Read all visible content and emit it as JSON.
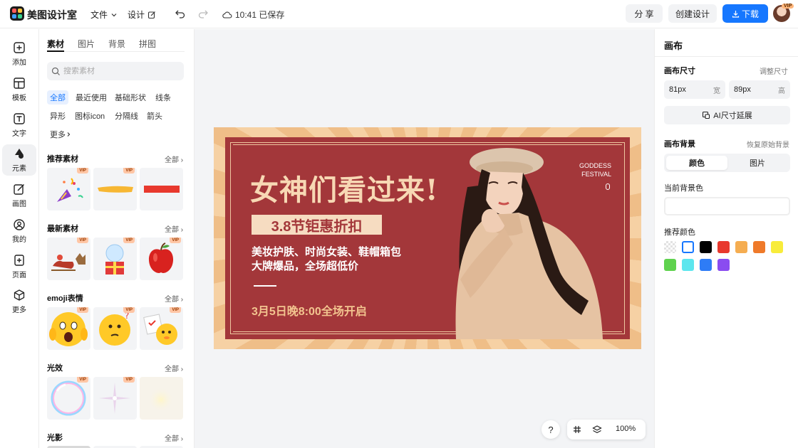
{
  "app": {
    "name": "美图设计室"
  },
  "header": {
    "file_menu": "文件",
    "design_menu": "设计",
    "save_status": "10:41 已保存",
    "share_label": "分 享",
    "create_label": "创建设计",
    "download_label": "下载",
    "vip_badge": "VIP"
  },
  "rail": {
    "items": [
      {
        "label": "添加",
        "icon": "plus-square-icon"
      },
      {
        "label": "模板",
        "icon": "template-icon"
      },
      {
        "label": "文字",
        "icon": "text-icon"
      },
      {
        "label": "元素",
        "icon": "shapes-icon"
      },
      {
        "label": "画图",
        "icon": "draw-icon"
      },
      {
        "label": "我的",
        "icon": "user-icon"
      },
      {
        "label": "页面",
        "icon": "add-page-icon"
      },
      {
        "label": "更多",
        "icon": "cube-icon"
      }
    ],
    "active": "元素"
  },
  "panel": {
    "tabs": [
      "素材",
      "图片",
      "背景",
      "拼图"
    ],
    "active_tab": "素材",
    "search_placeholder": "搜索素材",
    "chips": [
      "全部",
      "最近使用",
      "基础形状",
      "线条",
      "异形",
      "图标icon",
      "分隔线",
      "箭头",
      "更多"
    ],
    "active_chip": "全部",
    "sections": [
      {
        "title": "推荐素材",
        "all": "全部"
      },
      {
        "title": "最新素材",
        "all": "全部"
      },
      {
        "title": "emoji表情",
        "all": "全部"
      },
      {
        "title": "光效",
        "all": "全部"
      },
      {
        "title": "光影",
        "all": "全部"
      }
    ],
    "vip_label": "VIP"
  },
  "poster": {
    "headline": "女神们看过来!",
    "tag": "3.8节钜惠折扣",
    "line1": "美妆护肤、时尚女装、鞋帽箱包",
    "line2": "大牌爆品，全场超低价",
    "date": "3月5日晚8:00全场开启",
    "brand_line1": "GODDESS",
    "brand_line2": "FESTIVAL",
    "colors": {
      "background": "#a3373a",
      "accent": "#f7d8b4",
      "rays": "#efbe88"
    }
  },
  "toolbar": {
    "help": "?",
    "zoom": "100%"
  },
  "props": {
    "title": "画布",
    "size_label": "画布尺寸",
    "resize_link": "调整尺寸",
    "width_value": "81px",
    "width_unit": "宽",
    "height_value": "89px",
    "height_unit": "高",
    "ai_extend": "AI尺寸延展",
    "bg_label": "画布背景",
    "restore_link": "恢复原始背景",
    "seg_color": "颜色",
    "seg_image": "图片",
    "current_bg_label": "当前背景色",
    "recommended_label": "推荐颜色",
    "swatches": [
      "transparent",
      "#ffffff",
      "#000000",
      "#e8392e",
      "#f5ad51",
      "#ef7a2a",
      "#f8ec3b",
      "#5fd24e",
      "#5ce6ee",
      "#2e7cf6",
      "#8a4cf0"
    ]
  }
}
